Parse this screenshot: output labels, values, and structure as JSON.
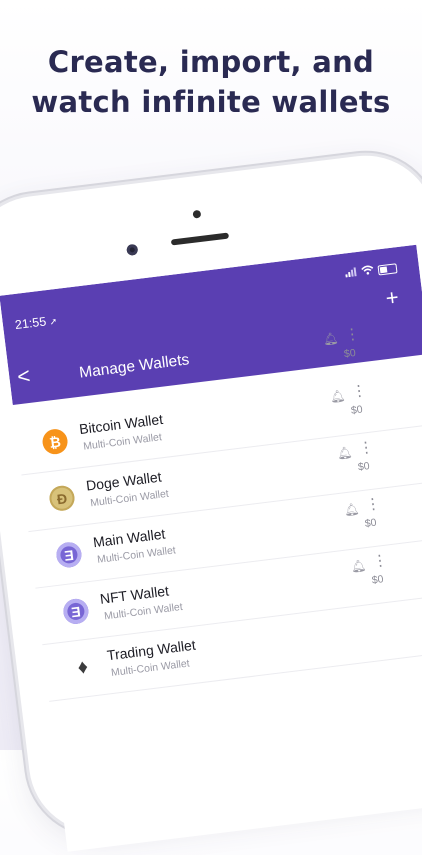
{
  "headline": {
    "line1": "Create, import, and",
    "line2": "watch infinite wallets"
  },
  "status_bar": {
    "time": "21:55",
    "location_icon": "location-arrow-icon",
    "signal_icon": "signal-icon",
    "wifi_icon": "wifi-icon",
    "battery_icon": "battery-icon"
  },
  "app_bar": {
    "title": "Manage Wallets",
    "back_icon": "chevron-left-icon",
    "add_icon": "plus-icon",
    "add_label": "+",
    "back_label": "<",
    "color": "#5a3fb2"
  },
  "first_row_actions": {
    "balance": "$0"
  },
  "wallets": [
    {
      "name": "Bitcoin Wallet",
      "type": "Multi-Coin Wallet",
      "balance": "$0",
      "icon": "bitcoin-icon",
      "glyph": "₿"
    },
    {
      "name": "Doge Wallet",
      "type": "Multi-Coin Wallet",
      "balance": "$0",
      "icon": "dogecoin-icon",
      "glyph": "Ð"
    },
    {
      "name": "Main Wallet",
      "type": "Multi-Coin Wallet",
      "balance": "$0",
      "icon": "enjin-icon",
      "glyph": "Ǝ"
    },
    {
      "name": "NFT Wallet",
      "type": "Multi-Coin Wallet",
      "balance": "",
      "icon": "enjin-icon",
      "glyph": "Ǝ"
    },
    {
      "name": "Trading Wallet",
      "type": "Multi-Coin Wallet",
      "balance": "",
      "icon": "ethereum-icon",
      "glyph": "♦"
    }
  ]
}
